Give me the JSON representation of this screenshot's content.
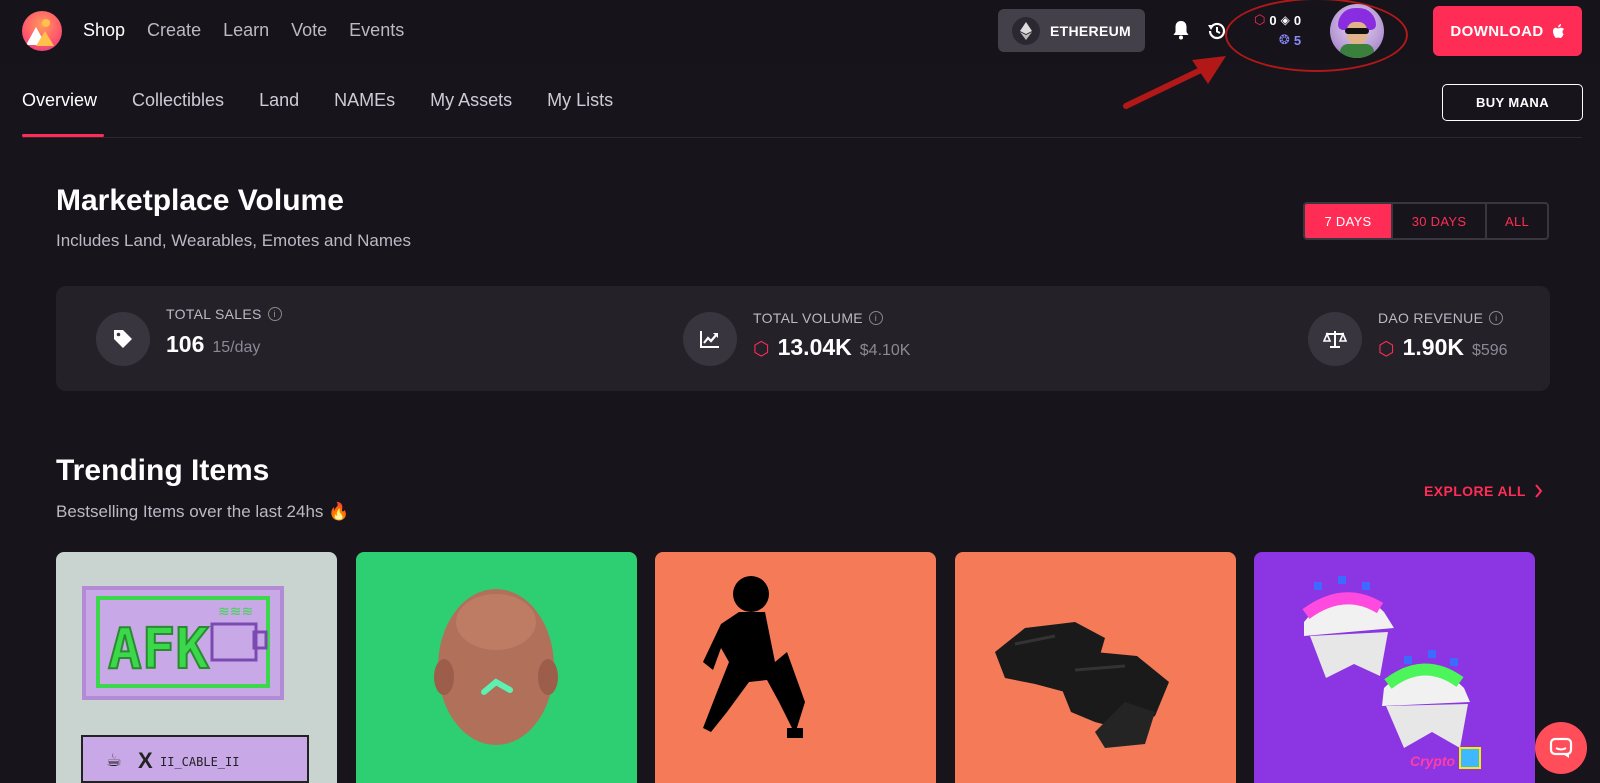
{
  "header": {
    "nav": [
      {
        "label": "Shop",
        "active": true
      },
      {
        "label": "Create"
      },
      {
        "label": "Learn"
      },
      {
        "label": "Vote"
      },
      {
        "label": "Events"
      }
    ],
    "network_label": "ETHEREUM",
    "balances": {
      "mana": "0",
      "eth": "0",
      "polygon": "5"
    },
    "download_label": "DOWNLOAD"
  },
  "subnav": {
    "tabs": [
      {
        "label": "Overview",
        "active": true
      },
      {
        "label": "Collectibles"
      },
      {
        "label": "Land"
      },
      {
        "label": "NAMEs"
      },
      {
        "label": "My Assets"
      },
      {
        "label": "My Lists"
      }
    ],
    "buy_mana_label": "BUY MANA"
  },
  "volume": {
    "title": "Marketplace Volume",
    "subtitle": "Includes Land, Wearables, Emotes and Names",
    "periods": [
      "7 DAYS",
      "30 DAYS",
      "ALL"
    ],
    "selected_period": "7 DAYS",
    "stats": {
      "sales": {
        "label": "TOTAL SALES",
        "value": "106",
        "secondary": "15/day"
      },
      "volume": {
        "label": "TOTAL VOLUME",
        "value": "13.04K",
        "secondary": "$4.10K"
      },
      "revenue": {
        "label": "DAO REVENUE",
        "value": "1.90K",
        "secondary": "$596"
      }
    }
  },
  "trending": {
    "title": "Trending Items",
    "subtitle": "Bestselling Items over the last 24hs 🔥",
    "explore_label": "EXPLORE ALL",
    "cards": [
      {
        "text": "AFK",
        "creator": "II_CABLE_II",
        "bg": "#c9d4d1"
      },
      {
        "bg": "#2ecf73"
      },
      {
        "bg": "#f47a58"
      },
      {
        "bg": "#f47a58"
      },
      {
        "text": "Crypto",
        "bg": "#8b35e3"
      }
    ]
  },
  "colors": {
    "accent": "#ff2d55",
    "background": "#18141c",
    "panel": "#242129"
  }
}
